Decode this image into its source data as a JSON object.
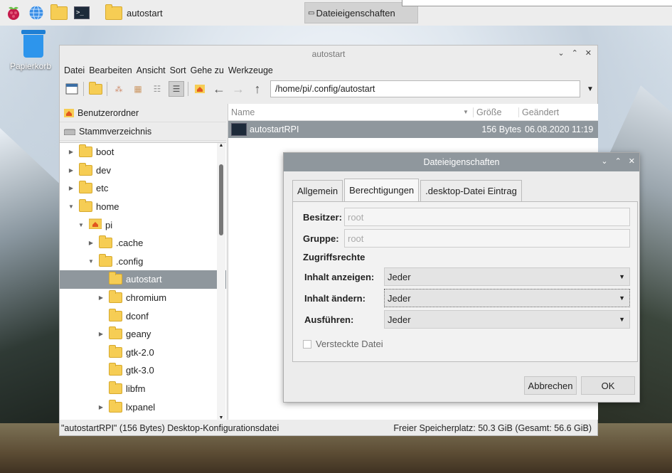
{
  "taskbar": {
    "icons": [
      "raspberry-menu-icon",
      "web-browser-icon",
      "file-manager-icon",
      "terminal-icon"
    ],
    "tasks": [
      {
        "label": "autostart",
        "icon": "folder-icon"
      },
      {
        "label": "Dateieigenschaften",
        "icon": "window-icon"
      }
    ]
  },
  "desktop": {
    "trash_label": "Papierkorb"
  },
  "file_manager": {
    "title": "autostart",
    "menu": [
      "Datei",
      "Bearbeiten",
      "Ansicht",
      "Sort",
      "Gehe zu",
      "Werkzeuge"
    ],
    "path": "/home/pi/.config/autostart",
    "places": [
      {
        "label": "Benutzerordner",
        "icon": "home-icon"
      },
      {
        "label": "Stammverzeichnis",
        "icon": "drive-icon"
      }
    ],
    "tree": [
      {
        "label": "boot",
        "indent": 0,
        "arrow": "▶"
      },
      {
        "label": "dev",
        "indent": 0,
        "arrow": "▶"
      },
      {
        "label": "etc",
        "indent": 0,
        "arrow": "▶"
      },
      {
        "label": "home",
        "indent": 0,
        "arrow": "▼"
      },
      {
        "label": "pi",
        "indent": 1,
        "arrow": "▼"
      },
      {
        "label": ".cache",
        "indent": 2,
        "arrow": "▶"
      },
      {
        "label": ".config",
        "indent": 2,
        "arrow": "▼"
      },
      {
        "label": "autostart",
        "indent": 3,
        "arrow": ""
      },
      {
        "label": "chromium",
        "indent": 3,
        "arrow": "▶"
      },
      {
        "label": "dconf",
        "indent": 3,
        "arrow": ""
      },
      {
        "label": "geany",
        "indent": 3,
        "arrow": "▶"
      },
      {
        "label": "gtk-2.0",
        "indent": 3,
        "arrow": ""
      },
      {
        "label": "gtk-3.0",
        "indent": 3,
        "arrow": ""
      },
      {
        "label": "libfm",
        "indent": 3,
        "arrow": ""
      },
      {
        "label": "lxpanel",
        "indent": 3,
        "arrow": "▶"
      }
    ],
    "columns": {
      "name": "Name",
      "size": "Größe",
      "modified": "Geändert"
    },
    "files": [
      {
        "name": "autostartRPI",
        "size": "156 Bytes",
        "modified": "06.08.2020 11:19"
      }
    ],
    "status_left": "\"autostartRPI\" (156 Bytes) Desktop-Konfigurationsdatei",
    "status_right": "Freier Speicherplatz: 50.3 GiB (Gesamt: 56.6 GiB)"
  },
  "dialog": {
    "title": "Dateieigenschaften",
    "tabs": [
      "Allgemein",
      "Berechtigungen",
      ".desktop-Datei Eintrag"
    ],
    "owner_label": "Besitzer:",
    "owner_value": "root",
    "group_label": "Gruppe:",
    "group_value": "root",
    "access_heading": "Zugriffsrechte",
    "perm_view_label": "Inhalt anzeigen:",
    "perm_view_value": "Jeder",
    "perm_change_label": "Inhalt ändern:",
    "perm_change_value": "Jeder",
    "perm_exec_label": "Ausführen:",
    "perm_exec_value": "Jeder",
    "hidden_label": "Versteckte Datei",
    "cancel_label": "Abbrechen",
    "ok_label": "OK"
  }
}
